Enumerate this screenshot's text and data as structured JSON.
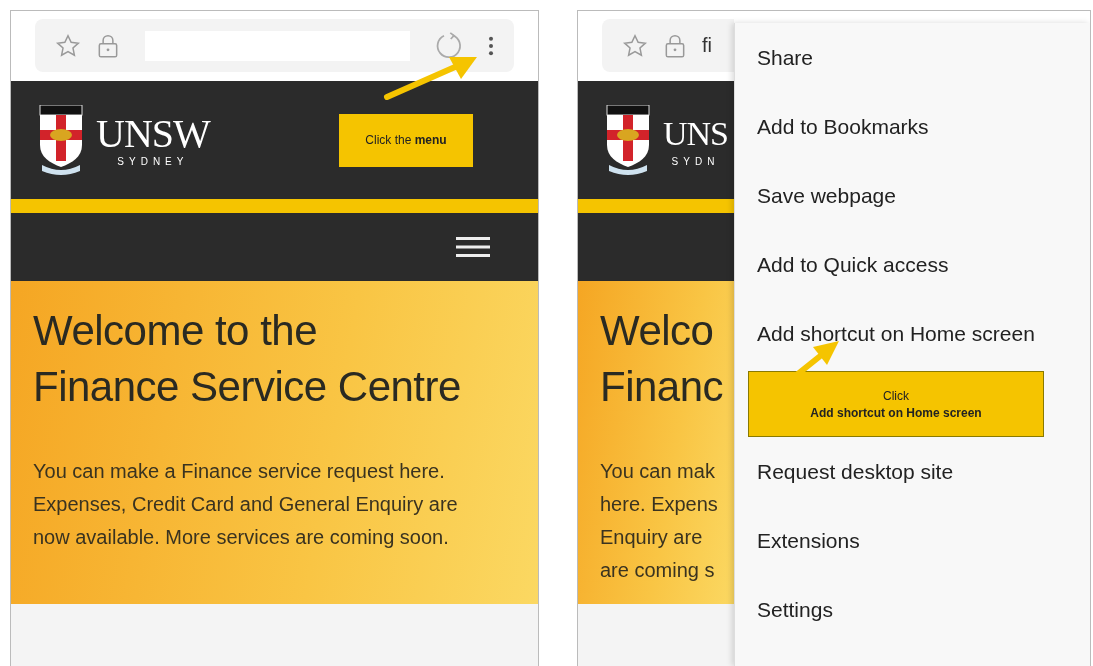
{
  "left_screen": {
    "logo": {
      "name": "UNSW",
      "sub": "SYDNEY"
    },
    "callout": "Click the **menu**",
    "title_lines": [
      "Welcome to the",
      "Finance Service Centre"
    ],
    "intro": "You can make a Finance service request here. Expenses, Credit Card and General Enquiry are now available. More services are coming soon."
  },
  "right_screen": {
    "url": "fi",
    "logo": {
      "name": "UNS",
      "sub": "SYDN"
    },
    "title_lines": [
      "Welco",
      "Financ"
    ],
    "intro_lines": [
      "You can mak",
      "here. Expens",
      "Enquiry are",
      "are coming s"
    ],
    "menu": [
      {
        "label": "Share"
      },
      {
        "label": "Add to Bookmarks"
      },
      {
        "label": "Save webpage"
      },
      {
        "label": "Add to Quick access"
      },
      {
        "label": "Add shortcut on Home screen"
      },
      {
        "label": "Request desktop site"
      },
      {
        "label": "Extensions"
      },
      {
        "label": "Settings"
      }
    ],
    "callout": {
      "line_1": "Click",
      "line_2": "Add shortcut on Home screen"
    }
  }
}
